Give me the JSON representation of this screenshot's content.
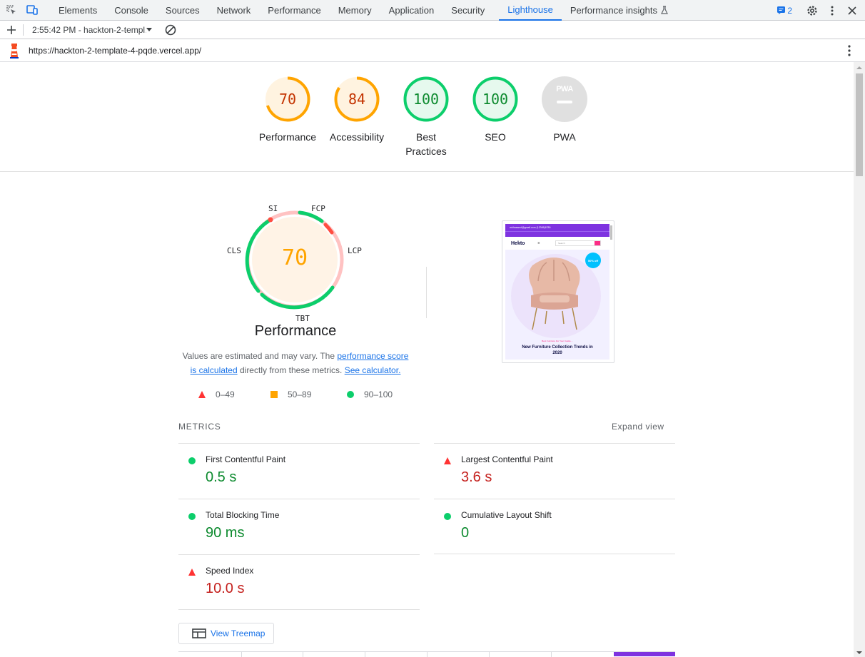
{
  "tabs": [
    "Elements",
    "Console",
    "Sources",
    "Network",
    "Performance",
    "Memory",
    "Application",
    "Security",
    "Lighthouse",
    "Performance insights"
  ],
  "active_tab": "Lighthouse",
  "issues_count": "2",
  "report_selector": "2:55:42 PM - hackton-2-templ…",
  "url": "https://hackton-2-template-4-pqde.vercel.app/",
  "scores": [
    {
      "value": "70",
      "label": "Performance",
      "score": 70,
      "color": "#e8710a"
    },
    {
      "value": "84",
      "label": "Accessibility",
      "score": 84,
      "color": "#e8710a"
    },
    {
      "value": "100",
      "label": "Best\nPractices",
      "score": 100,
      "color": "#0c8a2e"
    },
    {
      "value": "100",
      "label": "SEO",
      "score": 100,
      "color": "#0c8a2e"
    },
    {
      "value": "PWA",
      "label": "PWA",
      "score": 0,
      "color": "#9e9e9e"
    }
  ],
  "perf": {
    "score": "70",
    "title": "Performance",
    "segments": {
      "si": "SI",
      "fcp": "FCP",
      "lcp": "LCP",
      "cls": "CLS",
      "tbt": "TBT"
    },
    "desc_pre": "Values are estimated and may vary. The ",
    "desc_link1": "performance score is calculated",
    "desc_mid": " directly from these metrics. ",
    "desc_link2": "See calculator."
  },
  "legend": [
    "0–49",
    "50–89",
    "90–100"
  ],
  "metrics_heading": "METRICS",
  "expand_view": "Expand view",
  "metrics": [
    {
      "name": "First Contentful Paint",
      "value": "0.5 s",
      "rating": "pass"
    },
    {
      "name": "Largest Contentful Paint",
      "value": "3.6 s",
      "rating": "fail"
    },
    {
      "name": "Total Blocking Time",
      "value": "90 ms",
      "rating": "pass"
    },
    {
      "name": "Cumulative Layout Shift",
      "value": "0",
      "rating": "pass"
    },
    {
      "name": "Speed Index",
      "value": "10.0 s",
      "rating": "fail"
    }
  ],
  "view_treemap": "View Treemap",
  "screenshot": {
    "brand": "Hekto",
    "topbar": "mhhasanul@gmail.com   (12345)6789",
    "search_placeholder": "Search",
    "discount": "50% off",
    "tagline": "Best Furniture For Your Castle....",
    "headline": "New Furniture Collection Trends in 2020"
  },
  "colors": {
    "pass": "#0cce6b",
    "average": "#ffa400",
    "fail": "#ff4e42",
    "accent": "#1a73e8"
  }
}
